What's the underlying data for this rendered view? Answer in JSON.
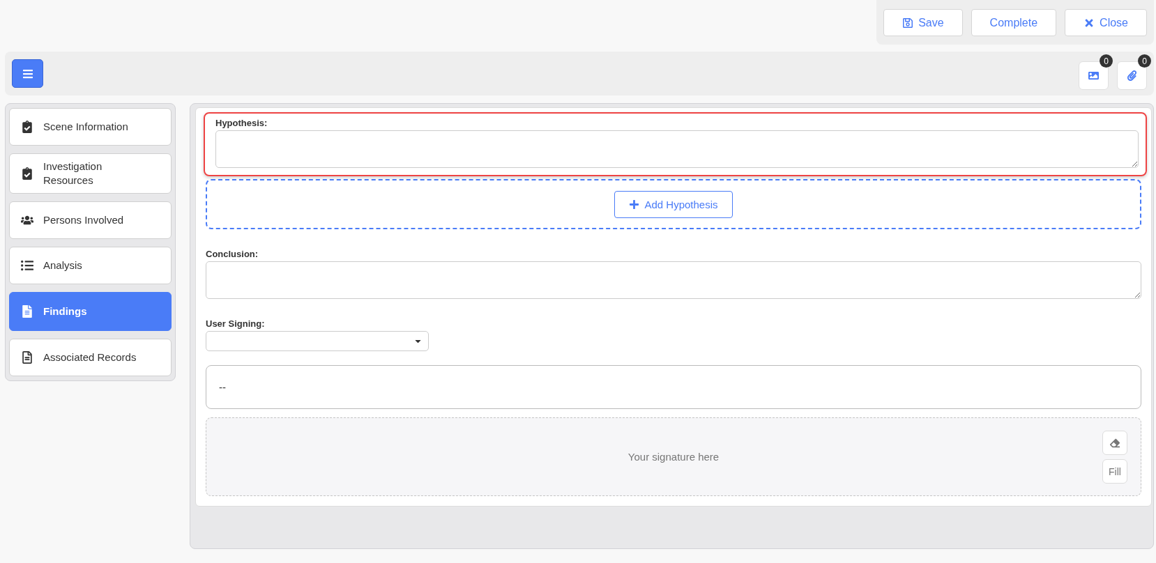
{
  "header_actions": [
    {
      "kind": "save",
      "label": "Save"
    },
    {
      "kind": "plain",
      "label": "Complete"
    },
    {
      "kind": "close",
      "label": "Close"
    }
  ],
  "toolbar": {
    "attachments": [
      {
        "kind": "image",
        "count": "0"
      },
      {
        "kind": "clip",
        "count": "0"
      }
    ]
  },
  "sidebar": {
    "items": [
      {
        "kind": "checklist",
        "label": "Scene Information",
        "selected": false
      },
      {
        "kind": "checklist",
        "label": "Investigation Resources",
        "selected": false
      },
      {
        "kind": "people",
        "label": "Persons Involved",
        "selected": false
      },
      {
        "kind": "list",
        "label": "Analysis",
        "selected": false
      },
      {
        "kind": "report",
        "label": "Findings",
        "selected": true
      },
      {
        "kind": "document",
        "label": "Associated Records",
        "selected": false
      }
    ]
  },
  "form": {
    "hypothesis": {
      "label": "Hypothesis:",
      "highlighted": true
    },
    "add_button": "Add Hypothesis",
    "conclusion": {
      "label": "Conclusion:"
    },
    "user_signing": {
      "label": "User Signing:"
    },
    "signer_display": "--",
    "signature": {
      "placeholder": "Your signature here",
      "fill_button": "Fill"
    }
  }
}
